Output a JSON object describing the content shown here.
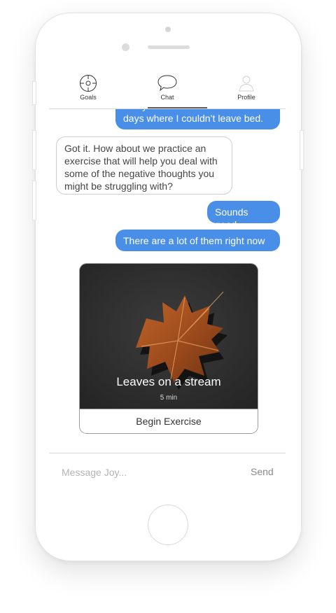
{
  "nav": {
    "items": [
      {
        "label": "Goals",
        "icon": "crosshair-icon"
      },
      {
        "label": "Chat",
        "icon": "speech-bubble-icon",
        "active": true
      },
      {
        "label": "Profile",
        "icon": "person-icon"
      }
    ]
  },
  "chat": {
    "messages": [
      {
        "from": "user",
        "text": "today. Kinda felt like one of those days where I couldn’t leave bed."
      },
      {
        "from": "bot",
        "text": "Got it. How about we practice an exercise that will help you deal with some of the negative thoughts you might be struggling with?"
      },
      {
        "from": "user",
        "text": "Sounds good"
      },
      {
        "from": "user",
        "text": "There are a lot of them right now"
      }
    ],
    "exercise_card": {
      "title": "Leaves on a stream",
      "duration": "5 min",
      "button": "Begin Exercise",
      "image": "autumn-leaf-on-dark-water"
    }
  },
  "composer": {
    "placeholder": "Message Joy...",
    "send_label": "Send"
  },
  "colors": {
    "user_bubble": "#4a8fe7",
    "bot_border": "#cfcfcf"
  }
}
